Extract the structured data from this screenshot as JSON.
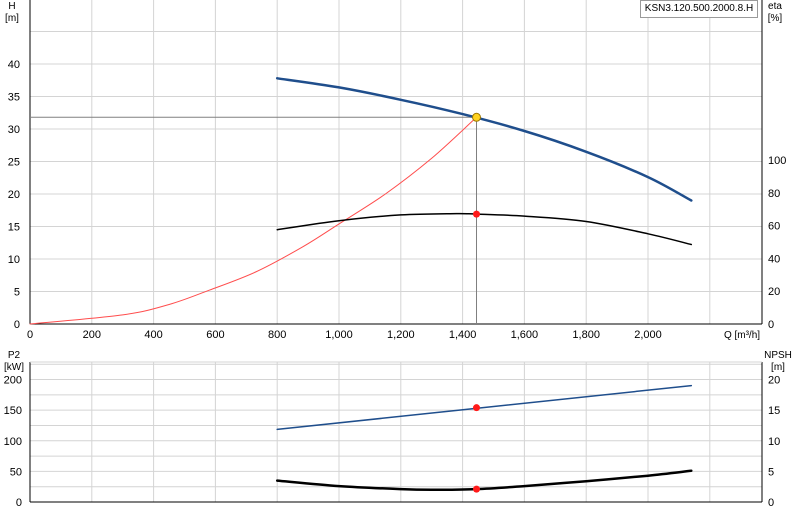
{
  "model_label": "KSN3.120.500.2000.8.H",
  "colors": {
    "head_curve": "#1f4e8c",
    "system_curve": "#ff4d4d",
    "efficiency_curve": "#000000",
    "power_curve": "#1f4e8c",
    "npsh_curve": "#000000",
    "duty_point_head": "#ffd21f",
    "duty_point_other": "#ff1a1a",
    "grid": "#d4d4d4"
  },
  "chart_data": [
    {
      "type": "line",
      "xlabel": "Q [m³/h]",
      "ylabel_left": [
        "H",
        "[m]"
      ],
      "ylabel_right": [
        "eta",
        "[%]"
      ],
      "xlim": [
        0,
        2400
      ],
      "ylim_left": [
        0,
        45
      ],
      "ylim_right": [
        0,
        100
      ],
      "x_ticks": [
        "0",
        "200",
        "400",
        "600",
        "800",
        "1,000",
        "1,200",
        "1,400",
        "1,600",
        "1,800",
        "2,000"
      ],
      "y_ticks_left": [
        "0",
        "5",
        "10",
        "15",
        "20",
        "25",
        "30",
        "35",
        "40"
      ],
      "y_ticks_right": [
        "0",
        "20",
        "40",
        "60",
        "80",
        "100"
      ],
      "grid": true,
      "series": [
        {
          "key": "head",
          "axis": "left",
          "x": [
            800,
            1000,
            1200,
            1400,
            1600,
            1800,
            2000,
            2140
          ],
          "values": [
            37.8,
            36.4,
            34.5,
            32.3,
            29.7,
            26.5,
            22.6,
            19.0
          ]
        },
        {
          "key": "system",
          "axis": "left",
          "x": [
            0,
            300,
            450,
            580,
            730,
            880,
            1000,
            1150,
            1300,
            1445
          ],
          "values": [
            0,
            1.4,
            3.0,
            5.2,
            8.0,
            11.8,
            15.4,
            20.0,
            25.5,
            31.8
          ]
        },
        {
          "key": "efficiency",
          "axis": "right",
          "x": [
            800,
            1000,
            1200,
            1380,
            1445,
            1600,
            1800,
            2000,
            2140
          ],
          "values": [
            57.5,
            63.0,
            66.5,
            67.3,
            67.0,
            65.8,
            62.5,
            55.0,
            48.5
          ]
        }
      ],
      "duty_point": {
        "x": 1445,
        "head": 31.8,
        "efficiency": 67.0
      }
    },
    {
      "type": "line",
      "ylabel_left": [
        "P2",
        "[kW]"
      ],
      "ylabel_right": [
        "NPSH",
        "[m]"
      ],
      "xlim": [
        0,
        2400
      ],
      "ylim_left": [
        0,
        225
      ],
      "ylim_right": [
        0,
        22.5
      ],
      "y_ticks_left": [
        "0",
        "50",
        "100",
        "150",
        "200"
      ],
      "y_ticks_right": [
        "0",
        "5",
        "10",
        "15",
        "20"
      ],
      "grid": true,
      "series": [
        {
          "key": "power",
          "axis": "left",
          "x": [
            800,
            2140
          ],
          "values": [
            118.5,
            190.0
          ]
        },
        {
          "key": "npsh",
          "axis": "right",
          "x": [
            800,
            1000,
            1200,
            1300,
            1445,
            1600,
            1800,
            2000,
            2140
          ],
          "values": [
            3.5,
            2.6,
            2.1,
            2.0,
            2.1,
            2.6,
            3.4,
            4.3,
            5.1
          ]
        }
      ],
      "duty_point": {
        "x": 1445,
        "power": 154.0,
        "npsh": 2.1
      }
    }
  ]
}
